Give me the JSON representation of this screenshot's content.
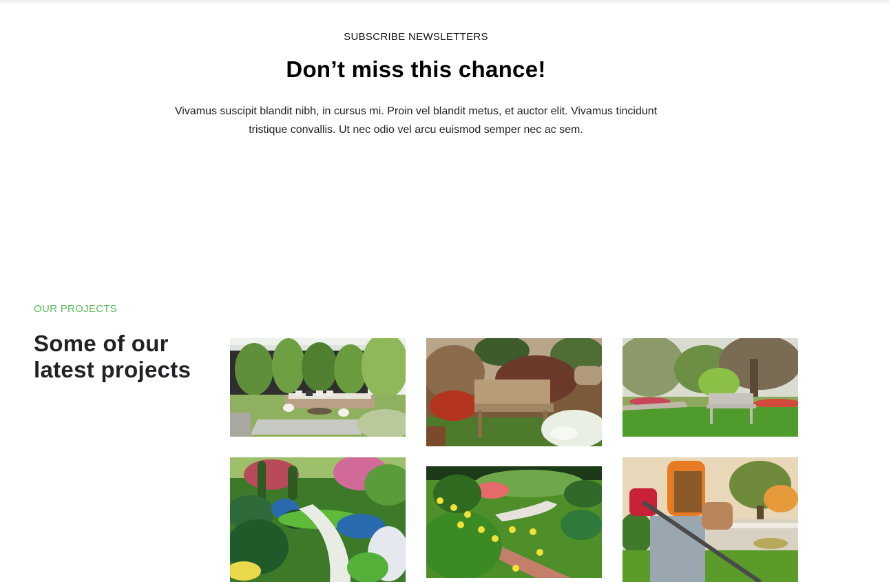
{
  "newsletter": {
    "eyebrow": "SUBSCRIBE NEWSLETTERS",
    "title": "Don’t miss this chance!",
    "description": "Vivamus suscipit blandit nibh, in cursus mi. Proin vel blandit metus, et auctor elit. Vivamus tincidunt tristique convallis. Ut nec odio vel arcu euismod semper nec ac sem."
  },
  "projects": {
    "eyebrow": "OUR PROJECTS",
    "title": "Some of our latest projects",
    "accent_color": "#5cb85c",
    "items": [
      {
        "name": "patio-lounge"
      },
      {
        "name": "wooden-bench-garden"
      },
      {
        "name": "park-bench-lawn"
      },
      {
        "name": "flower-path-garden"
      },
      {
        "name": "daylily-brick-path"
      },
      {
        "name": "grass-trimmer-worker"
      }
    ]
  }
}
